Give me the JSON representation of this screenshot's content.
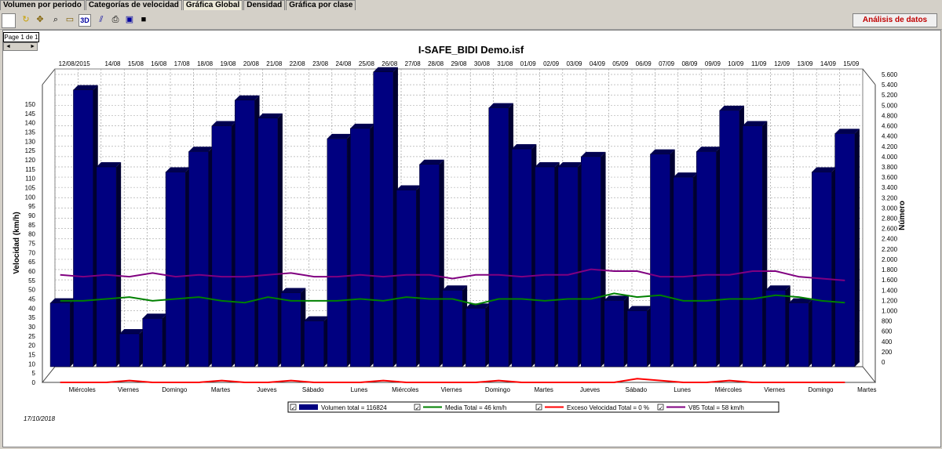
{
  "tabs": [
    "Volumen por periodo",
    "Categorías de velocidad",
    "Gráfica Global",
    "Densidad",
    "Gráfica por clase"
  ],
  "active_tab": "Gráfica Global",
  "toolbar": {
    "analisis_label": "Análisis de datos",
    "view_3d_label": "3D"
  },
  "page_label": "Page 1 de 1",
  "page_nav": {
    "prev": "◄",
    "next": "►"
  },
  "footer_date": "17/10/2018",
  "chart_data": {
    "type": "bar",
    "title": "I-SAFE_BIDI Demo.isf",
    "ylabel_left": "Velocidad (km/h)",
    "ylabel_right": "Número",
    "ylim_left": [
      0,
      150
    ],
    "ylim_right": [
      0,
      5600
    ],
    "left_ticks": [
      0,
      5,
      10,
      15,
      20,
      25,
      30,
      35,
      40,
      45,
      50,
      55,
      60,
      65,
      70,
      75,
      80,
      85,
      90,
      95,
      100,
      105,
      110,
      115,
      120,
      125,
      130,
      135,
      140,
      145,
      150
    ],
    "right_ticks": [
      0,
      200,
      400,
      600,
      800,
      1000,
      1200,
      1400,
      1600,
      1800,
      2000,
      2200,
      2400,
      2600,
      2800,
      3000,
      3200,
      3400,
      3600,
      3800,
      4000,
      4200,
      4400,
      4600,
      4800,
      5000,
      5200,
      5400,
      5600
    ],
    "right_tick_labels": [
      "0",
      "200",
      "400",
      "600",
      "800",
      "1.000",
      "1.200",
      "1.400",
      "1.600",
      "1.800",
      "2.000",
      "2.200",
      "2.400",
      "2.600",
      "2.800",
      "3.000",
      "3.200",
      "3.400",
      "3.600",
      "3.800",
      "4.000",
      "4.200",
      "4.400",
      "4.600",
      "4.800",
      "5.000",
      "5.200",
      "5.400",
      "5.600"
    ],
    "top_dates": [
      "12/08/2015",
      "14/08",
      "15/08",
      "16/08",
      "17/08",
      "18/08",
      "19/08",
      "20/08",
      "21/08",
      "22/08",
      "23/08",
      "24/08",
      "25/08",
      "26/08",
      "27/08",
      "28/08",
      "29/08",
      "30/08",
      "31/08",
      "01/09",
      "02/09",
      "03/09",
      "04/09",
      "05/09",
      "06/09",
      "07/09",
      "08/09",
      "09/09",
      "10/09",
      "11/09",
      "12/09",
      "13/09",
      "14/09",
      "15/09"
    ],
    "bottom_days": [
      "Miércoles",
      "Viernes",
      "Domingo",
      "Martes",
      "Jueves",
      "Sábado",
      "Lunes",
      "Miércoles",
      "Viernes",
      "Domingo",
      "Martes",
      "Jueves",
      "Sábado",
      "Lunes",
      "Miércoles",
      "Viernes",
      "Domingo",
      "Martes"
    ],
    "grid": true,
    "legend_position": "bottom",
    "series": [
      {
        "name": "Volumen total = 116824",
        "kind": "bar",
        "axis": "right",
        "color": "#000080",
        "values": [
          1150,
          5300,
          3800,
          550,
          850,
          3700,
          4100,
          4600,
          5100,
          4750,
          1350,
          800,
          4350,
          4550,
          5650,
          3350,
          3850,
          1400,
          1050,
          4950,
          4150,
          3800,
          3800,
          4000,
          1200,
          1000,
          4050,
          3600,
          4100,
          4900,
          4600,
          1400,
          1150,
          3700,
          4450
        ]
      },
      {
        "name": "Media Total = 46 km/h",
        "kind": "line",
        "axis": "left",
        "color": "#008000",
        "values": [
          44,
          44,
          45,
          46,
          44,
          45,
          46,
          44,
          43,
          46,
          44,
          44,
          44,
          45,
          44,
          46,
          45,
          45,
          42,
          45,
          45,
          44,
          45,
          45,
          48,
          46,
          47,
          44,
          44,
          45,
          45,
          47,
          46,
          44,
          43
        ]
      },
      {
        "name": "Exceso Velocidad Total = 0 %",
        "kind": "line",
        "axis": "left",
        "color": "#ff0000",
        "values": [
          0,
          0,
          0,
          1,
          0,
          0,
          0,
          1,
          0,
          0,
          1,
          0,
          0,
          0,
          1,
          0,
          0,
          0,
          0,
          1,
          0,
          0,
          0,
          0,
          0,
          2,
          1,
          0,
          0,
          1,
          0,
          0,
          0,
          0,
          0
        ]
      },
      {
        "name": "V85 Total = 58 km/h",
        "kind": "line",
        "axis": "left",
        "color": "#800080",
        "values": [
          58,
          57,
          58,
          57,
          59,
          57,
          58,
          57,
          57,
          58,
          59,
          57,
          57,
          58,
          57,
          58,
          58,
          56,
          58,
          58,
          57,
          58,
          58,
          61,
          60,
          60,
          57,
          57,
          58,
          58,
          60,
          60,
          57,
          56,
          55
        ]
      }
    ]
  }
}
